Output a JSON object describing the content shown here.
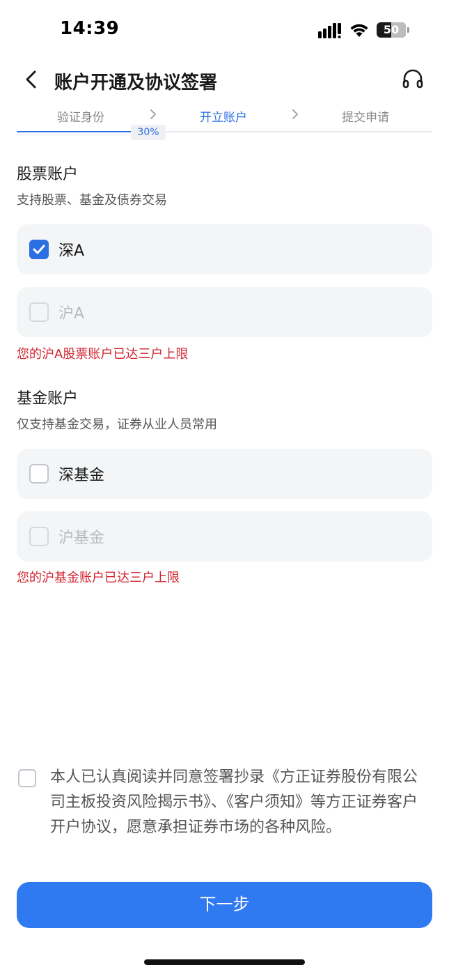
{
  "status_bar": {
    "time": "14:39",
    "battery": "50"
  },
  "nav": {
    "title": "账户开通及协议签署"
  },
  "steps": {
    "items": [
      "验证身份",
      "开立账户",
      "提交申请"
    ],
    "progress_label": "30%",
    "progress_percent": 30
  },
  "stock_account": {
    "title": "股票账户",
    "subtitle": "支持股票、基金及债券交易",
    "options": [
      {
        "label": "深A",
        "checked": true,
        "disabled": false
      },
      {
        "label": "沪A",
        "checked": false,
        "disabled": true
      }
    ],
    "error": "您的沪A股票账户已达三户上限"
  },
  "fund_account": {
    "title": "基金账户",
    "subtitle": "仅支持基金交易，证券从业人员常用",
    "options": [
      {
        "label": "深基金",
        "checked": false,
        "disabled": false
      },
      {
        "label": "沪基金",
        "checked": false,
        "disabled": true
      }
    ],
    "error": "您的沪基金账户已达三户上限"
  },
  "agreement": {
    "text": "本人已认真阅读并同意签署抄录《方正证券股份有限公司主板投资风险揭示书》、《客户须知》等方正证券客户开户协议，愿意承担证券市场的各种风险。"
  },
  "next_button": {
    "label": "下一步"
  },
  "colors": {
    "accent": "#2c6fe0",
    "button": "#2f7af0",
    "error": "#d0232f"
  }
}
